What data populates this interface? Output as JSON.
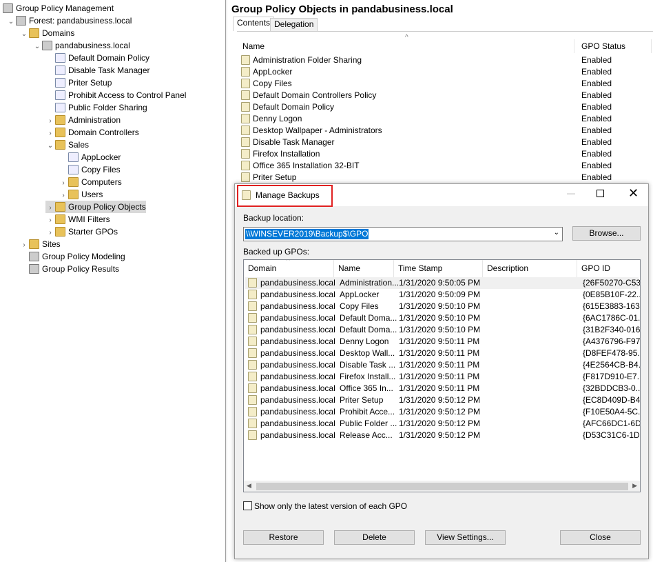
{
  "tree": [
    {
      "label": "Group Policy Management",
      "indent": 0,
      "chev": "",
      "icon": "root"
    },
    {
      "label": "Forest: pandabusiness.local",
      "indent": 1,
      "chev": "v",
      "icon": "forest"
    },
    {
      "label": "Domains",
      "indent": 2,
      "chev": "v",
      "icon": "folder"
    },
    {
      "label": "pandabusiness.local",
      "indent": 3,
      "chev": "v",
      "icon": "domain"
    },
    {
      "label": "Default Domain Policy",
      "indent": 4,
      "chev": "",
      "icon": "gpo"
    },
    {
      "label": "Disable Task Manager",
      "indent": 4,
      "chev": "",
      "icon": "gpo"
    },
    {
      "label": "Priter Setup",
      "indent": 4,
      "chev": "",
      "icon": "gpo"
    },
    {
      "label": "Prohibit Access to Control Panel",
      "indent": 4,
      "chev": "",
      "icon": "gpo"
    },
    {
      "label": "Public Folder Sharing",
      "indent": 4,
      "chev": "",
      "icon": "gpo"
    },
    {
      "label": "Administration",
      "indent": 4,
      "chev": ">",
      "icon": "folder"
    },
    {
      "label": "Domain Controllers",
      "indent": 4,
      "chev": ">",
      "icon": "folder"
    },
    {
      "label": "Sales",
      "indent": 4,
      "chev": "v",
      "icon": "folder"
    },
    {
      "label": "AppLocker",
      "indent": 5,
      "chev": "",
      "icon": "gpo"
    },
    {
      "label": "Copy Files",
      "indent": 5,
      "chev": "",
      "icon": "gpo"
    },
    {
      "label": "Computers",
      "indent": 5,
      "chev": ">",
      "icon": "folder"
    },
    {
      "label": "Users",
      "indent": 5,
      "chev": ">",
      "icon": "folder"
    },
    {
      "label": "Group Policy Objects",
      "indent": 4,
      "chev": ">",
      "icon": "folder",
      "selected": true
    },
    {
      "label": "WMI Filters",
      "indent": 4,
      "chev": ">",
      "icon": "folder"
    },
    {
      "label": "Starter GPOs",
      "indent": 4,
      "chev": ">",
      "icon": "folder"
    },
    {
      "label": "Sites",
      "indent": 2,
      "chev": ">",
      "icon": "folder"
    },
    {
      "label": "Group Policy Modeling",
      "indent": 2,
      "chev": "",
      "icon": "root"
    },
    {
      "label": "Group Policy Results",
      "indent": 2,
      "chev": "",
      "icon": "root"
    }
  ],
  "right": {
    "title": "Group Policy Objects in pandabusiness.local",
    "tabs": [
      "Contents",
      "Delegation"
    ],
    "columns": [
      "Name",
      "GPO Status"
    ],
    "rows": [
      [
        "Administration Folder Sharing",
        "Enabled"
      ],
      [
        "AppLocker",
        "Enabled"
      ],
      [
        "Copy Files",
        "Enabled"
      ],
      [
        "Default Domain Controllers Policy",
        "Enabled"
      ],
      [
        "Default Domain Policy",
        "Enabled"
      ],
      [
        "Denny Logon",
        "Enabled"
      ],
      [
        "Desktop Wallpaper - Administrators",
        "Enabled"
      ],
      [
        "Disable Task Manager",
        "Enabled"
      ],
      [
        "Firefox Installation",
        "Enabled"
      ],
      [
        "Office 365 Installation 32-BIT",
        "Enabled"
      ],
      [
        "Priter Setup",
        "Enabled"
      ]
    ]
  },
  "dialog": {
    "title": "Manage Backups",
    "backup_location_label": "Backup location:",
    "backup_location": "\\\\WINSEVER2019\\Backup$\\GPO",
    "browse": "Browse...",
    "backed_up_label": "Backed up GPOs:",
    "columns": [
      "Domain",
      "Name",
      "Time Stamp",
      "Description",
      "GPO ID"
    ],
    "rows": [
      [
        "pandabusiness.local",
        "Administration...",
        "1/31/2020 9:50:05 PM",
        "",
        "{26F50270-C53..."
      ],
      [
        "pandabusiness.local",
        "AppLocker",
        "1/31/2020 9:50:09 PM",
        "",
        "{0E85B10F-22..."
      ],
      [
        "pandabusiness.local",
        "Copy Files",
        "1/31/2020 9:50:10 PM",
        "",
        "{615E3883-163..."
      ],
      [
        "pandabusiness.local",
        "Default Doma...",
        "1/31/2020 9:50:10 PM",
        "",
        "{6AC1786C-01..."
      ],
      [
        "pandabusiness.local",
        "Default Doma...",
        "1/31/2020 9:50:10 PM",
        "",
        "{31B2F340-016..."
      ],
      [
        "pandabusiness.local",
        "Denny Logon",
        "1/31/2020 9:50:11 PM",
        "",
        "{A4376796-F97..."
      ],
      [
        "pandabusiness.local",
        "Desktop Wall...",
        "1/31/2020 9:50:11 PM",
        "",
        "{D8FEF478-95..."
      ],
      [
        "pandabusiness.local",
        "Disable Task ...",
        "1/31/2020 9:50:11 PM",
        "",
        "{4E2564CB-B4..."
      ],
      [
        "pandabusiness.local",
        "Firefox Install...",
        "1/31/2020 9:50:11 PM",
        "",
        "{F817D910-E7..."
      ],
      [
        "pandabusiness.local",
        "Office 365 In...",
        "1/31/2020 9:50:11 PM",
        "",
        "{32BDDCB3-0..."
      ],
      [
        "pandabusiness.local",
        "Priter Setup",
        "1/31/2020 9:50:12 PM",
        "",
        "{EC8D409D-B4..."
      ],
      [
        "pandabusiness.local",
        "Prohibit Acce...",
        "1/31/2020 9:50:12 PM",
        "",
        "{F10E50A4-5C..."
      ],
      [
        "pandabusiness.local",
        "Public Folder ...",
        "1/31/2020 9:50:12 PM",
        "",
        "{AFC66DC1-6D..."
      ],
      [
        "pandabusiness.local",
        "Release Acc...",
        "1/31/2020 9:50:12 PM",
        "",
        "{D53C31C6-1D..."
      ]
    ],
    "checkbox_label": "Show only the latest version of each GPO",
    "checkbox_checked": false,
    "buttons": {
      "restore": "Restore",
      "delete": "Delete",
      "view": "View Settings...",
      "close": "Close"
    },
    "highlight_color": "#e02020"
  }
}
